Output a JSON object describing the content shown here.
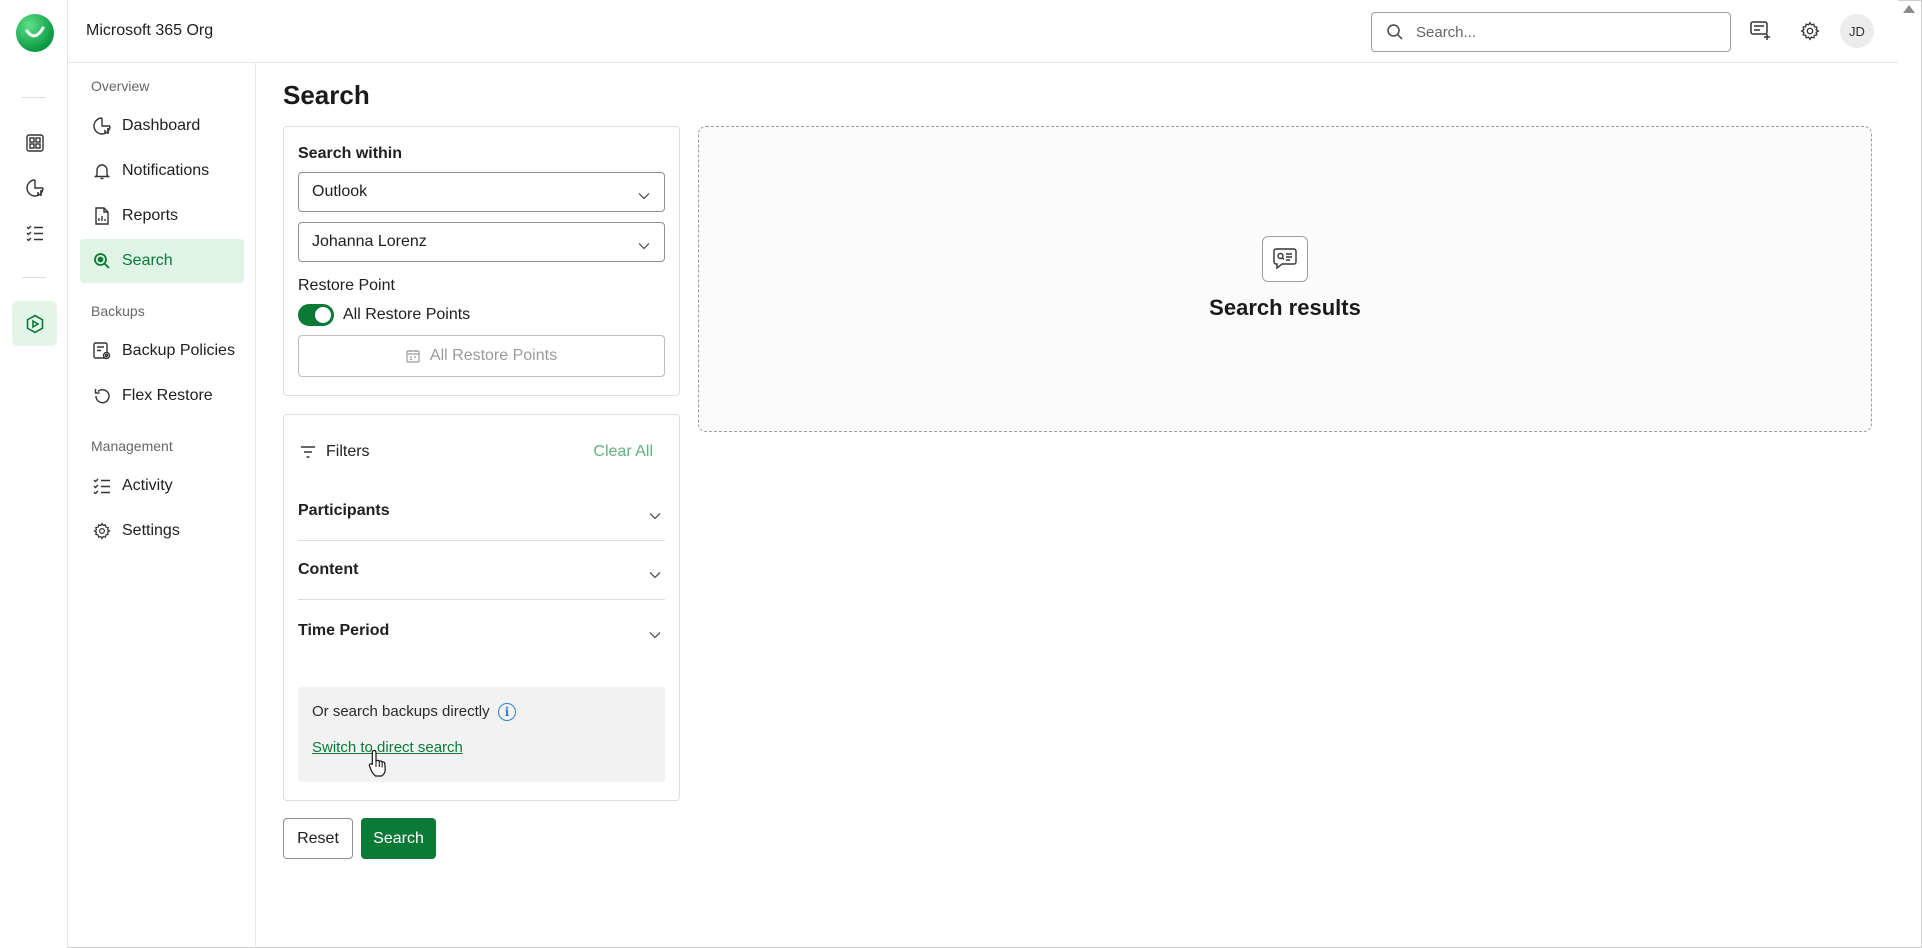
{
  "header": {
    "org_name": "Microsoft 365 Org",
    "search_placeholder": "Search...",
    "avatar_initials": "JD"
  },
  "rail": {
    "icons": [
      "dashboard-grid-icon",
      "reports-icon",
      "checklist-icon",
      "backup-product-icon"
    ]
  },
  "nav": {
    "sections": {
      "overview": "Overview",
      "backups": "Backups",
      "management": "Management"
    },
    "items": [
      {
        "label": "Dashboard",
        "icon": "dashboard-icon"
      },
      {
        "label": "Notifications",
        "icon": "bell-icon"
      },
      {
        "label": "Reports",
        "icon": "report-icon"
      },
      {
        "label": "Search",
        "icon": "search-icon",
        "active": true
      },
      {
        "label": "Backup Policies",
        "icon": "policy-icon"
      },
      {
        "label": "Flex Restore",
        "icon": "restore-icon"
      },
      {
        "label": "Activity",
        "icon": "activity-icon"
      },
      {
        "label": "Settings",
        "icon": "gear-icon"
      }
    ]
  },
  "page": {
    "title": "Search"
  },
  "search_within": {
    "label": "Search within",
    "service_value": "Outlook",
    "user_value": "Johanna Lorenz",
    "restore_point_label": "Restore Point",
    "toggle_label": "All Restore Points",
    "toggle_on": true,
    "restore_points_button": "All Restore Points"
  },
  "filters": {
    "title": "Filters",
    "clear_all": "Clear All",
    "sections": [
      "Participants",
      "Content",
      "Time Period"
    ],
    "direct_search_text": "Or search backups directly",
    "direct_search_link": "Switch to direct search"
  },
  "actions": {
    "reset": "Reset",
    "search": "Search"
  },
  "results": {
    "title": "Search results"
  },
  "colors": {
    "accent": "#0b7a37",
    "active_bg": "#dff4e5",
    "link_muted": "#5fb17b",
    "info": "#2f7fd6"
  }
}
